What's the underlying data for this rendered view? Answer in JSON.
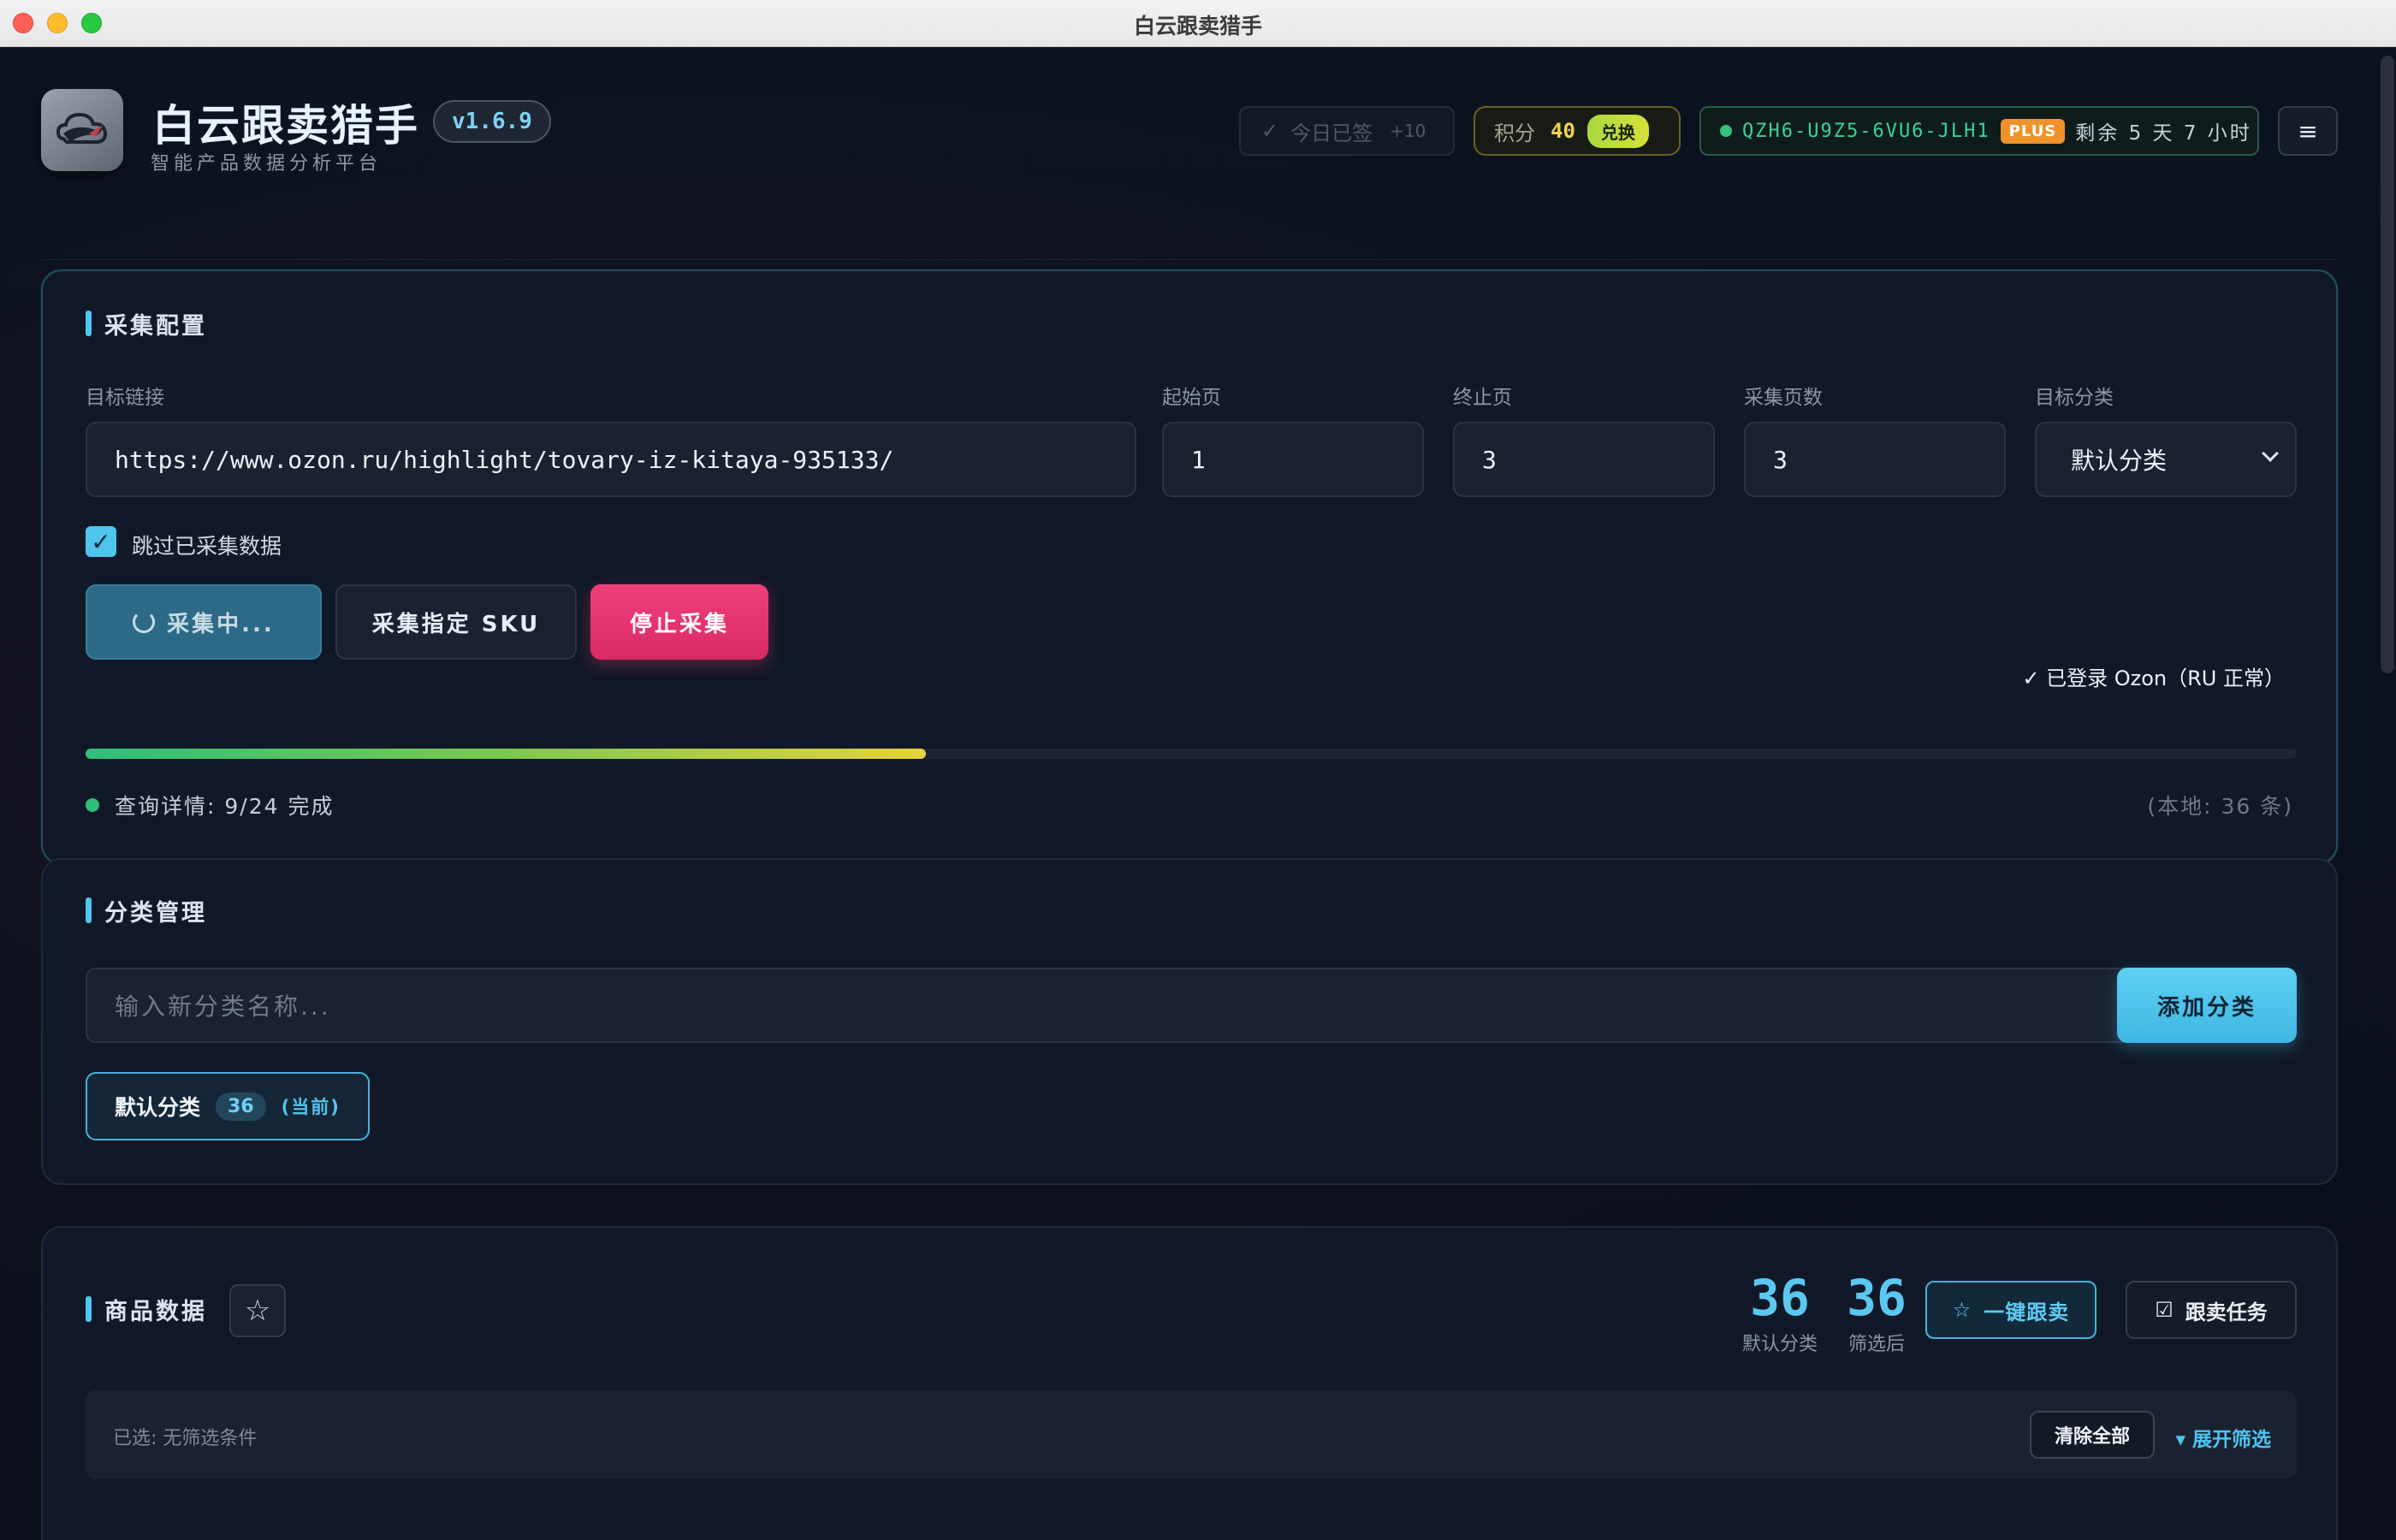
{
  "window": {
    "title": "白云跟卖猎手"
  },
  "header": {
    "app_title": "白云跟卖猎手",
    "subtitle": "智能产品数据分析平台",
    "version": "v1.6.9",
    "checkin": {
      "label": "今日已签",
      "bonus": "+10"
    },
    "points": {
      "label": "积分",
      "value": "40",
      "redeem": "兑换"
    },
    "license": {
      "code": "QZH6-U9Z5-6VU6-JLH1",
      "tier": "PLUS",
      "remaining": "剩余 5 天 7 小时"
    }
  },
  "collect_config": {
    "title": "采集配置",
    "target_link": {
      "label": "目标链接",
      "value": "https://www.ozon.ru/highlight/tovary-iz-kitaya-935133/"
    },
    "start_page": {
      "label": "起始页",
      "value": "1"
    },
    "end_page": {
      "label": "终止页",
      "value": "3"
    },
    "page_count": {
      "label": "采集页数",
      "value": "3"
    },
    "target_category": {
      "label": "目标分类",
      "value": "默认分类"
    },
    "skip_collected": {
      "label": "跳过已采集数据",
      "checked": true
    },
    "buttons": {
      "collecting": "采集中...",
      "collect_sku": "采集指定 SKU",
      "stop": "停止采集"
    },
    "login_status": "✓ 已登录 Ozon（RU 正常）",
    "progress": 0.38,
    "status_text": "查询详情: 9/24 完成",
    "local_count": "(本地: 36 条)"
  },
  "category_manage": {
    "title": "分类管理",
    "input_placeholder": "输入新分类名称...",
    "add_button": "添加分类",
    "categories": [
      {
        "name": "默认分类",
        "count": "36",
        "current": "(当前)"
      }
    ]
  },
  "product_data": {
    "title": "商品数据",
    "stats": [
      {
        "value": "36",
        "label": "默认分类"
      },
      {
        "value": "36",
        "label": "筛选后"
      }
    ],
    "follow_button": "一键跟卖",
    "tasks_button": "跟卖任务",
    "filter": {
      "selected_label": "已选:",
      "selected_value": "无筛选条件",
      "clear_all": "清除全部",
      "expand": "▾ 展开筛选"
    }
  },
  "colors": {
    "accent": "#4fc7ef",
    "stop": "#e83470",
    "success": "#2fbf7a",
    "points": "#f3d34a",
    "plus": "#f0922b"
  }
}
